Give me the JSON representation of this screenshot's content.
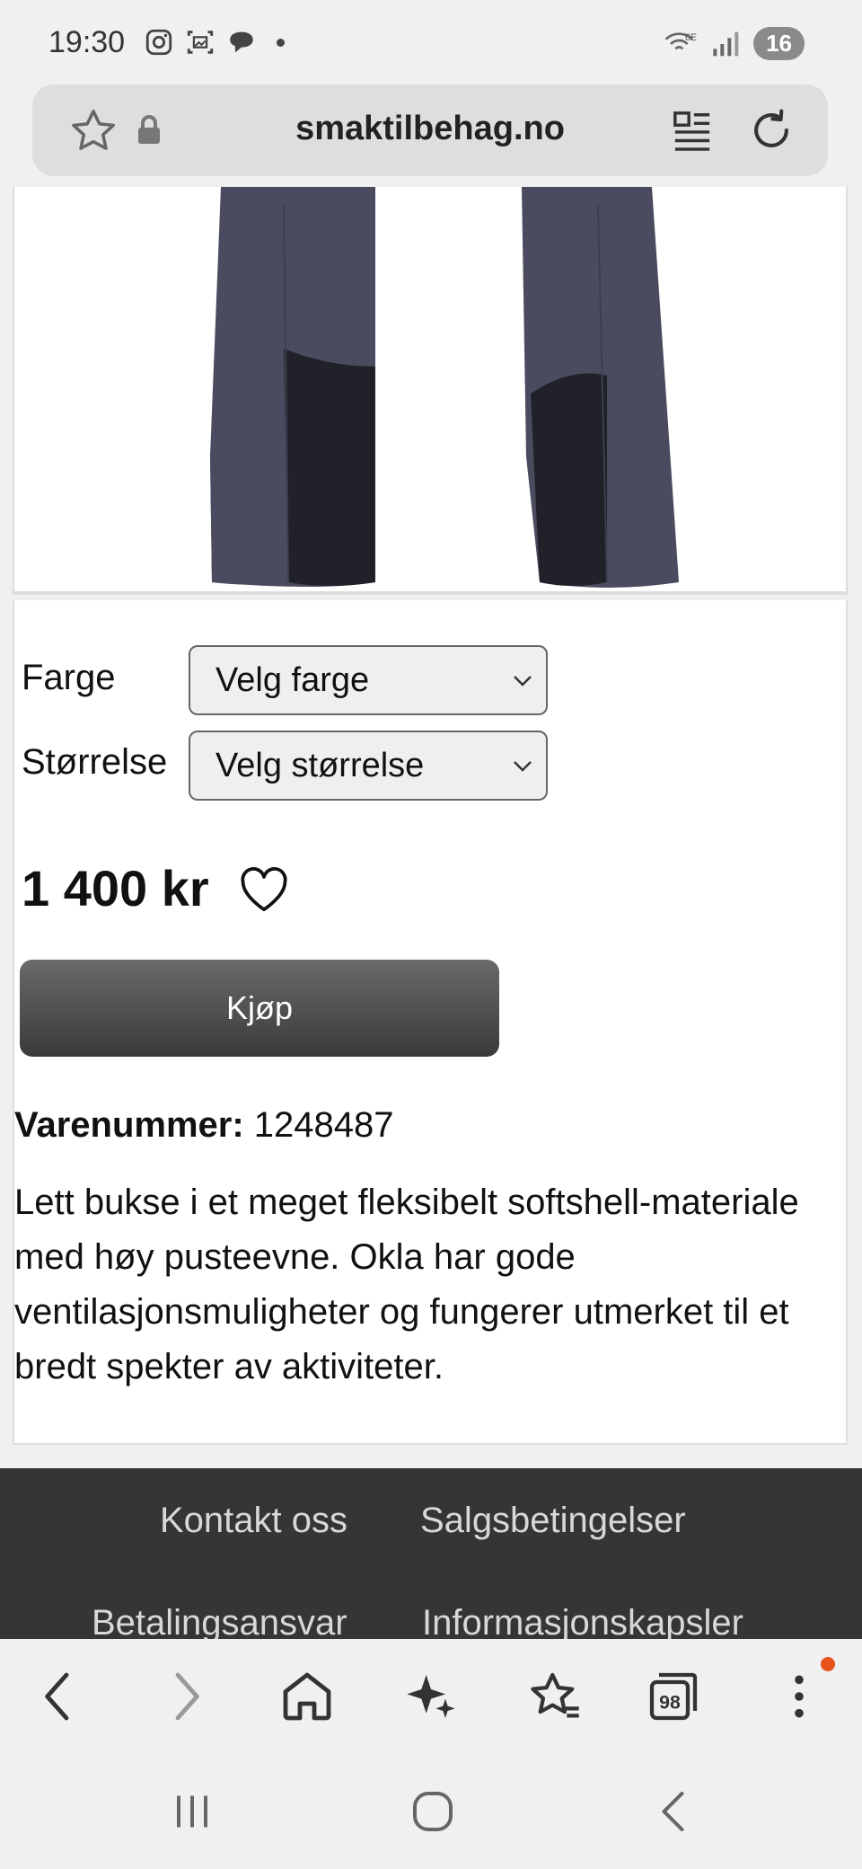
{
  "status_bar": {
    "time": "19:30",
    "battery": "16",
    "left_icons": [
      "instagram-icon",
      "gallery-icon",
      "chat-icon"
    ],
    "right_icons": [
      "wifi-6e-icon",
      "signal-icon"
    ]
  },
  "browser": {
    "url": "smaktilbehag.no"
  },
  "product": {
    "color_label": "Farge",
    "color_select": "Velg farge",
    "size_label": "Størrelse",
    "size_select": "Velg størrelse",
    "price": "1 400 kr",
    "buy_label": "Kjøp",
    "sku_label": "Varenummer:",
    "sku_value": "1248487",
    "description": "Lett bukse i et meget fleksibelt softshell-materiale med høy pusteevne. Okla har gode ventilasjonsmuligheter og fungerer utmerket til et bredt spekter av aktiviteter."
  },
  "footer": {
    "links": [
      "Kontakt oss",
      "Salgsbetingelser",
      "Betalingsansvar",
      "Informasjonskapsler"
    ]
  },
  "toolbar": {
    "tabs_count": "98",
    "icons": [
      "back-icon",
      "forward-icon",
      "home-icon",
      "sparkle-icon",
      "bookmarks-icon",
      "tabs-icon",
      "menu-icon"
    ]
  },
  "colors": {
    "footer_bg": "#363434",
    "button_dark": "#3a3a3a",
    "notification": "#e8521d",
    "pants": "#4a4b5e"
  }
}
